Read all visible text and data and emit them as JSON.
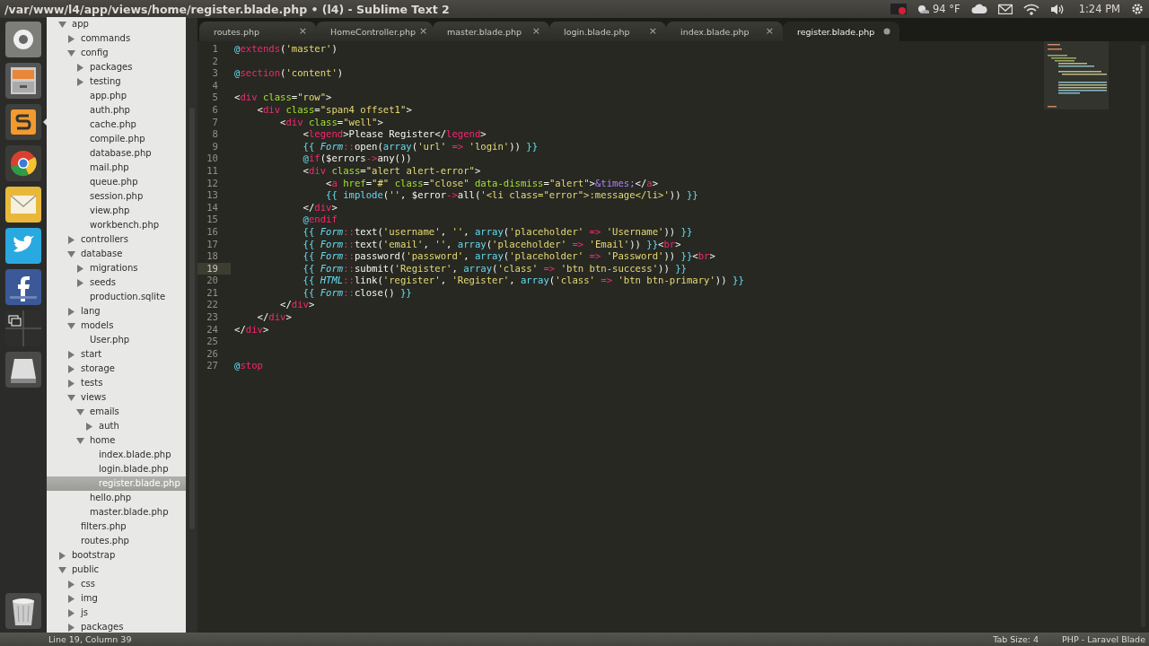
{
  "window": {
    "title": "/var/www/l4/app/views/home/register.blade.php • (l4) - Sublime Text 2"
  },
  "panel": {
    "temperature": "94 °F",
    "clock": "1:24 PM"
  },
  "launcher": [
    {
      "kind": "dash",
      "selected": false
    },
    {
      "kind": "files",
      "selected": false
    },
    {
      "kind": "editor",
      "selected": true
    },
    {
      "kind": "browser",
      "selected": false
    },
    {
      "kind": "mail",
      "selected": false
    },
    {
      "kind": "bird",
      "selected": false
    },
    {
      "kind": "social",
      "selected": false
    },
    {
      "kind": "workspaces",
      "selected": false
    },
    {
      "kind": "drive",
      "selected": false
    },
    {
      "kind": "trash",
      "selected": false
    }
  ],
  "sidebar": {
    "items": [
      {
        "label": "app",
        "kind": "folder",
        "expanded": true,
        "selected": false,
        "children": [
          {
            "label": "commands",
            "kind": "folder",
            "expanded": false,
            "selected": false
          },
          {
            "label": "config",
            "kind": "folder",
            "expanded": true,
            "selected": false,
            "children": [
              {
                "label": "packages",
                "kind": "folder",
                "expanded": false,
                "selected": false
              },
              {
                "label": "testing",
                "kind": "folder",
                "expanded": false,
                "selected": false
              },
              {
                "label": "app.php",
                "kind": "file",
                "selected": false
              },
              {
                "label": "auth.php",
                "kind": "file",
                "selected": false
              },
              {
                "label": "cache.php",
                "kind": "file",
                "selected": false
              },
              {
                "label": "compile.php",
                "kind": "file",
                "selected": false
              },
              {
                "label": "database.php",
                "kind": "file",
                "selected": false
              },
              {
                "label": "mail.php",
                "kind": "file",
                "selected": false
              },
              {
                "label": "queue.php",
                "kind": "file",
                "selected": false
              },
              {
                "label": "session.php",
                "kind": "file",
                "selected": false
              },
              {
                "label": "view.php",
                "kind": "file",
                "selected": false
              },
              {
                "label": "workbench.php",
                "kind": "file",
                "selected": false
              }
            ]
          },
          {
            "label": "controllers",
            "kind": "folder",
            "expanded": false,
            "selected": false
          },
          {
            "label": "database",
            "kind": "folder",
            "expanded": true,
            "selected": false,
            "children": [
              {
                "label": "migrations",
                "kind": "folder",
                "expanded": false,
                "selected": false
              },
              {
                "label": "seeds",
                "kind": "folder",
                "expanded": false,
                "selected": false
              },
              {
                "label": "production.sqlite",
                "kind": "file",
                "selected": false
              }
            ]
          },
          {
            "label": "lang",
            "kind": "folder",
            "expanded": false,
            "selected": false
          },
          {
            "label": "models",
            "kind": "folder",
            "expanded": true,
            "selected": false,
            "children": [
              {
                "label": "User.php",
                "kind": "file",
                "selected": false
              }
            ]
          },
          {
            "label": "start",
            "kind": "folder",
            "expanded": false,
            "selected": false
          },
          {
            "label": "storage",
            "kind": "folder",
            "expanded": false,
            "selected": false
          },
          {
            "label": "tests",
            "kind": "folder",
            "expanded": false,
            "selected": false
          },
          {
            "label": "views",
            "kind": "folder",
            "expanded": true,
            "selected": false,
            "children": [
              {
                "label": "emails",
                "kind": "folder",
                "expanded": true,
                "selected": false,
                "children": [
                  {
                    "label": "auth",
                    "kind": "folder",
                    "expanded": false,
                    "selected": false
                  }
                ]
              },
              {
                "label": "home",
                "kind": "folder",
                "expanded": true,
                "selected": false,
                "children": [
                  {
                    "label": "index.blade.php",
                    "kind": "file",
                    "selected": false
                  },
                  {
                    "label": "login.blade.php",
                    "kind": "file",
                    "selected": false
                  },
                  {
                    "label": "register.blade.php",
                    "kind": "file",
                    "selected": true
                  }
                ]
              },
              {
                "label": "hello.php",
                "kind": "file",
                "selected": false
              },
              {
                "label": "master.blade.php",
                "kind": "file",
                "selected": false
              }
            ]
          },
          {
            "label": "filters.php",
            "kind": "file",
            "selected": false
          },
          {
            "label": "routes.php",
            "kind": "file",
            "selected": false
          }
        ]
      },
      {
        "label": "bootstrap",
        "kind": "folder",
        "expanded": false,
        "selected": false
      },
      {
        "label": "public",
        "kind": "folder",
        "expanded": true,
        "selected": false,
        "children": [
          {
            "label": "css",
            "kind": "folder",
            "expanded": false,
            "selected": false
          },
          {
            "label": "img",
            "kind": "folder",
            "expanded": false,
            "selected": false
          },
          {
            "label": "js",
            "kind": "folder",
            "expanded": false,
            "selected": false
          },
          {
            "label": "packages",
            "kind": "folder",
            "expanded": false,
            "selected": false
          }
        ]
      }
    ]
  },
  "tabs": [
    {
      "label": "routes.php",
      "selected": false,
      "modified": false,
      "close": "×"
    },
    {
      "label": "HomeController.php",
      "selected": false,
      "modified": false,
      "close": "×"
    },
    {
      "label": "master.blade.php",
      "selected": false,
      "modified": false,
      "close": "×"
    },
    {
      "label": "login.blade.php",
      "selected": false,
      "modified": false,
      "close": "×"
    },
    {
      "label": "index.blade.php",
      "selected": false,
      "modified": false,
      "close": "×"
    },
    {
      "label": "register.blade.php",
      "selected": true,
      "modified": true
    }
  ],
  "editor": {
    "lines": [
      {
        "number": "1",
        "current": false,
        "tokens": [
          {
            "kind": "at",
            "text": "@"
          },
          {
            "kind": "directive",
            "text": "extends"
          },
          {
            "kind": "plain",
            "text": "("
          },
          {
            "kind": "string",
            "text": "'master'"
          },
          {
            "kind": "plain",
            "text": ")"
          }
        ]
      },
      {
        "number": "2",
        "current": false
      },
      {
        "number": "3",
        "current": false,
        "tokens": [
          {
            "kind": "at",
            "text": "@"
          },
          {
            "kind": "directive",
            "text": "section"
          },
          {
            "kind": "plain",
            "text": "("
          },
          {
            "kind": "string",
            "text": "'content'"
          },
          {
            "kind": "plain",
            "text": ")"
          }
        ]
      },
      {
        "number": "4",
        "current": false
      },
      {
        "number": "5",
        "current": false,
        "tokens": [
          {
            "kind": "plain",
            "text": "<"
          },
          {
            "kind": "tag",
            "text": "div"
          },
          {
            "kind": "attr",
            "text": " class"
          },
          {
            "kind": "plain",
            "text": "="
          },
          {
            "kind": "string",
            "text": "\"row\""
          },
          {
            "kind": "plain",
            "text": ">"
          }
        ]
      },
      {
        "number": "6",
        "current": false,
        "tokens": [
          {
            "kind": "plain",
            "text": "    <"
          },
          {
            "kind": "tag",
            "text": "div"
          },
          {
            "kind": "attr",
            "text": " class"
          },
          {
            "kind": "plain",
            "text": "="
          },
          {
            "kind": "string",
            "text": "\"span4 offset1\""
          },
          {
            "kind": "plain",
            "text": ">"
          }
        ]
      },
      {
        "number": "7",
        "current": false,
        "tokens": [
          {
            "kind": "plain",
            "text": "        <"
          },
          {
            "kind": "tag",
            "text": "div"
          },
          {
            "kind": "attr",
            "text": " class"
          },
          {
            "kind": "plain",
            "text": "="
          },
          {
            "kind": "string",
            "text": "\"well\""
          },
          {
            "kind": "plain",
            "text": ">"
          }
        ]
      },
      {
        "number": "8",
        "current": false,
        "tokens": [
          {
            "kind": "plain",
            "text": "            <"
          },
          {
            "kind": "tag",
            "text": "legend"
          },
          {
            "kind": "plain",
            "text": ">Please Register</"
          },
          {
            "kind": "tag",
            "text": "legend"
          },
          {
            "kind": "plain",
            "text": ">"
          }
        ]
      },
      {
        "number": "9",
        "current": false,
        "tokens": [
          {
            "kind": "brace",
            "text": "            {{"
          },
          {
            "kind": "class",
            "text": " Form"
          },
          {
            "kind": "op",
            "text": "::"
          },
          {
            "kind": "plain",
            "text": "open("
          },
          {
            "kind": "func",
            "text": "array"
          },
          {
            "kind": "plain",
            "text": "("
          },
          {
            "kind": "string",
            "text": "'url'"
          },
          {
            "kind": "op",
            "text": " =>"
          },
          {
            "kind": "string",
            "text": " 'login'"
          },
          {
            "kind": "plain",
            "text": "))"
          },
          {
            "kind": "brace",
            "text": " }}"
          }
        ]
      },
      {
        "number": "10",
        "current": false,
        "tokens": [
          {
            "kind": "at",
            "text": "            @"
          },
          {
            "kind": "directive",
            "text": "if"
          },
          {
            "kind": "plain",
            "text": "($errors"
          },
          {
            "kind": "op",
            "text": "->"
          },
          {
            "kind": "plain",
            "text": "any())"
          }
        ]
      },
      {
        "number": "11",
        "current": false,
        "tokens": [
          {
            "kind": "plain",
            "text": "            <"
          },
          {
            "kind": "tag",
            "text": "div"
          },
          {
            "kind": "attr",
            "text": " class"
          },
          {
            "kind": "plain",
            "text": "="
          },
          {
            "kind": "string",
            "text": "\"alert alert-error\""
          },
          {
            "kind": "plain",
            "text": ">"
          }
        ]
      },
      {
        "number": "12",
        "current": false,
        "tokens": [
          {
            "kind": "plain",
            "text": "                <"
          },
          {
            "kind": "tag",
            "text": "a"
          },
          {
            "kind": "attr",
            "text": " href"
          },
          {
            "kind": "plain",
            "text": "="
          },
          {
            "kind": "string",
            "text": "\"#\""
          },
          {
            "kind": "attr",
            "text": " class"
          },
          {
            "kind": "plain",
            "text": "="
          },
          {
            "kind": "string",
            "text": "\"close\""
          },
          {
            "kind": "attr",
            "text": " data-dismiss"
          },
          {
            "kind": "plain",
            "text": "="
          },
          {
            "kind": "string",
            "text": "\"alert\""
          },
          {
            "kind": "plain",
            "text": ">"
          },
          {
            "kind": "entity",
            "text": "&times;"
          },
          {
            "kind": "plain",
            "text": "</"
          },
          {
            "kind": "tag",
            "text": "a"
          },
          {
            "kind": "plain",
            "text": ">"
          }
        ]
      },
      {
        "number": "13",
        "current": false,
        "tokens": [
          {
            "kind": "brace",
            "text": "                {{"
          },
          {
            "kind": "func",
            "text": " implode"
          },
          {
            "kind": "plain",
            "text": "("
          },
          {
            "kind": "string",
            "text": "''"
          },
          {
            "kind": "plain",
            "text": ", $error"
          },
          {
            "kind": "op",
            "text": "->"
          },
          {
            "kind": "plain",
            "text": "all("
          },
          {
            "kind": "string",
            "text": "'<li class=\"error\">:message</li>'"
          },
          {
            "kind": "plain",
            "text": "))"
          },
          {
            "kind": "brace",
            "text": " }}"
          }
        ]
      },
      {
        "number": "14",
        "current": false,
        "tokens": [
          {
            "kind": "plain",
            "text": "            </"
          },
          {
            "kind": "tag",
            "text": "div"
          },
          {
            "kind": "plain",
            "text": ">"
          }
        ]
      },
      {
        "number": "15",
        "current": false,
        "tokens": [
          {
            "kind": "at",
            "text": "            @"
          },
          {
            "kind": "directive",
            "text": "endif"
          }
        ]
      },
      {
        "number": "16",
        "current": false,
        "tokens": [
          {
            "kind": "brace",
            "text": "            {{"
          },
          {
            "kind": "class",
            "text": " Form"
          },
          {
            "kind": "op",
            "text": "::"
          },
          {
            "kind": "plain",
            "text": "text("
          },
          {
            "kind": "string",
            "text": "'username'"
          },
          {
            "kind": "plain",
            "text": ","
          },
          {
            "kind": "string",
            "text": " ''"
          },
          {
            "kind": "plain",
            "text": ","
          },
          {
            "kind": "func",
            "text": " array"
          },
          {
            "kind": "plain",
            "text": "("
          },
          {
            "kind": "string",
            "text": "'placeholder'"
          },
          {
            "kind": "op",
            "text": " =>"
          },
          {
            "kind": "string",
            "text": " 'Username'"
          },
          {
            "kind": "plain",
            "text": "))"
          },
          {
            "kind": "brace",
            "text": " }}"
          }
        ]
      },
      {
        "number": "17",
        "current": false,
        "tokens": [
          {
            "kind": "brace",
            "text": "            {{"
          },
          {
            "kind": "class",
            "text": " Form"
          },
          {
            "kind": "op",
            "text": "::"
          },
          {
            "kind": "plain",
            "text": "text("
          },
          {
            "kind": "string",
            "text": "'email'"
          },
          {
            "kind": "plain",
            "text": ","
          },
          {
            "kind": "string",
            "text": " ''"
          },
          {
            "kind": "plain",
            "text": ","
          },
          {
            "kind": "func",
            "text": " array"
          },
          {
            "kind": "plain",
            "text": "("
          },
          {
            "kind": "string",
            "text": "'placeholder'"
          },
          {
            "kind": "op",
            "text": " =>"
          },
          {
            "kind": "string",
            "text": " 'Email'"
          },
          {
            "kind": "plain",
            "text": "))"
          },
          {
            "kind": "brace",
            "text": " }}"
          },
          {
            "kind": "plain",
            "text": "<"
          },
          {
            "kind": "tag",
            "text": "br"
          },
          {
            "kind": "plain",
            "text": ">"
          }
        ]
      },
      {
        "number": "18",
        "current": false,
        "tokens": [
          {
            "kind": "brace",
            "text": "            {{"
          },
          {
            "kind": "class",
            "text": " Form"
          },
          {
            "kind": "op",
            "text": "::"
          },
          {
            "kind": "plain",
            "text": "password("
          },
          {
            "kind": "string",
            "text": "'password'"
          },
          {
            "kind": "plain",
            "text": ","
          },
          {
            "kind": "func",
            "text": " array"
          },
          {
            "kind": "plain",
            "text": "("
          },
          {
            "kind": "string",
            "text": "'placeholder'"
          },
          {
            "kind": "op",
            "text": " =>"
          },
          {
            "kind": "string",
            "text": " 'Password'"
          },
          {
            "kind": "plain",
            "text": "))"
          },
          {
            "kind": "brace",
            "text": " }}"
          },
          {
            "kind": "plain",
            "text": "<"
          },
          {
            "kind": "tag",
            "text": "br"
          },
          {
            "kind": "plain",
            "text": ">"
          }
        ]
      },
      {
        "number": "19",
        "current": true,
        "tokens": [
          {
            "kind": "brace",
            "text": "            {{"
          },
          {
            "kind": "class",
            "text": " Form"
          },
          {
            "kind": "op",
            "text": "::"
          },
          {
            "kind": "plain",
            "text": "submit("
          },
          {
            "kind": "string",
            "text": "'Register'"
          },
          {
            "kind": "plain",
            "text": ","
          },
          {
            "kind": "func",
            "text": " array"
          },
          {
            "kind": "plain",
            "text": "("
          },
          {
            "kind": "string",
            "text": "'class'"
          },
          {
            "kind": "op",
            "text": " =>"
          },
          {
            "kind": "string",
            "text": " 'btn btn-success'"
          },
          {
            "kind": "plain",
            "text": "))"
          },
          {
            "kind": "brace",
            "text": " }}"
          }
        ]
      },
      {
        "number": "20",
        "current": false,
        "tokens": [
          {
            "kind": "brace",
            "text": "            {{"
          },
          {
            "kind": "class",
            "text": " HTML"
          },
          {
            "kind": "op",
            "text": "::"
          },
          {
            "kind": "plain",
            "text": "link("
          },
          {
            "kind": "string",
            "text": "'register'"
          },
          {
            "kind": "plain",
            "text": ","
          },
          {
            "kind": "string",
            "text": " 'Register'"
          },
          {
            "kind": "plain",
            "text": ","
          },
          {
            "kind": "func",
            "text": " array"
          },
          {
            "kind": "plain",
            "text": "("
          },
          {
            "kind": "string",
            "text": "'class'"
          },
          {
            "kind": "op",
            "text": " =>"
          },
          {
            "kind": "string",
            "text": " 'btn btn-primary'"
          },
          {
            "kind": "plain",
            "text": "))"
          },
          {
            "kind": "brace",
            "text": " }}"
          }
        ]
      },
      {
        "number": "21",
        "current": false,
        "tokens": [
          {
            "kind": "brace",
            "text": "            {{"
          },
          {
            "kind": "class",
            "text": " Form"
          },
          {
            "kind": "op",
            "text": "::"
          },
          {
            "kind": "plain",
            "text": "close()"
          },
          {
            "kind": "brace",
            "text": " }}"
          }
        ]
      },
      {
        "number": "22",
        "current": false,
        "tokens": [
          {
            "kind": "plain",
            "text": "        </"
          },
          {
            "kind": "tag",
            "text": "div"
          },
          {
            "kind": "plain",
            "text": ">"
          }
        ]
      },
      {
        "number": "23",
        "current": false,
        "tokens": [
          {
            "kind": "plain",
            "text": "    </"
          },
          {
            "kind": "tag",
            "text": "div"
          },
          {
            "kind": "plain",
            "text": ">"
          }
        ]
      },
      {
        "number": "24",
        "current": false,
        "tokens": [
          {
            "kind": "plain",
            "text": "</"
          },
          {
            "kind": "tag",
            "text": "div"
          },
          {
            "kind": "plain",
            "text": ">"
          }
        ]
      },
      {
        "number": "25",
        "current": false
      },
      {
        "number": "26",
        "current": false
      },
      {
        "number": "27",
        "current": false,
        "tokens": [
          {
            "kind": "at",
            "text": "@"
          },
          {
            "kind": "directive",
            "text": "stop"
          }
        ]
      }
    ]
  },
  "status_bar": {
    "position": "Line 19, Column 39",
    "tab_size": "Tab Size: 4",
    "syntax": "PHP - Laravel Blade"
  }
}
